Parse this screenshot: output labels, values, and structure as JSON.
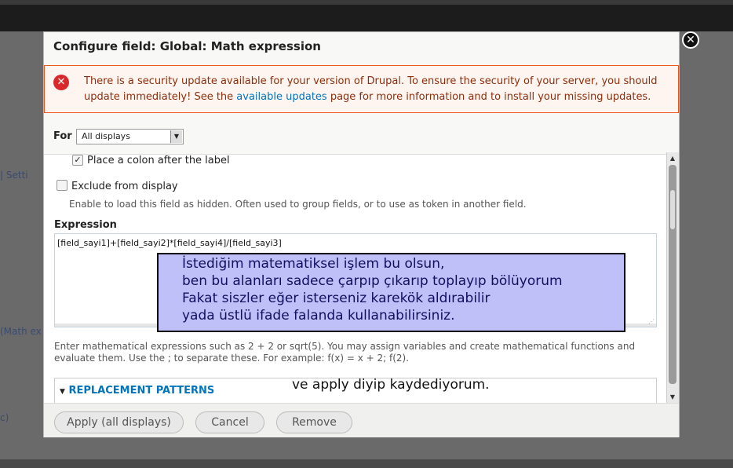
{
  "background": {
    "text_1": "|  Setti",
    "text_2": "(Math ex",
    "text_3": "c)"
  },
  "modal": {
    "title": "Configure field: Global: Math expression",
    "close_symbol": "✕"
  },
  "alert": {
    "icon": "error-icon",
    "text_before": "There is a security update available for your version of Drupal. To ensure the security of your server, you should update immediately! See the ",
    "link_text": "available updates",
    "text_after": " page for more information and to install your missing updates."
  },
  "for_row": {
    "label": "For",
    "selected": "All displays"
  },
  "form": {
    "colon_checkbox_label": "Place a colon after the label",
    "colon_checked": true,
    "exclude_label": "Exclude from display",
    "exclude_checked": false,
    "exclude_description": "Enable to load this field as hidden. Often used to group fields, or to use as token in another field.",
    "expression_label": "Expression",
    "expression_value": "[field_sayi1]+[field_sayi2]*[field_sayi4]/[field_sayi3]",
    "help_text": "Enter mathematical expressions such as 2 + 2 or sqrt(5). You may assign variables and create mathematical functions and evaluate them. Use the ; to separate these. For example: f(x) = x + 2; f(2).",
    "replacement_patterns_label": "REPLACEMENT PATTERNS"
  },
  "buttons": {
    "apply": "Apply (all displays)",
    "cancel": "Cancel",
    "remove": "Remove"
  },
  "annotation": {
    "line1": "İstediğim matematiksel işlem bu olsun,",
    "line2": "ben bu alanları sadece çarpıp çıkarıp toplayıp bölüyorum",
    "line3": "Fakat siszler eğer isterseniz karekök aldırabilir",
    "line4": "yada üstlü ifade falanda kullanabilirsiniz."
  },
  "caption": "ve apply diyip kaydediyorum.",
  "colors": {
    "alert_border": "#ed541d",
    "alert_text": "#8c2e0b",
    "link": "#0074bd",
    "annotation_bg": "#c0c0f8"
  }
}
